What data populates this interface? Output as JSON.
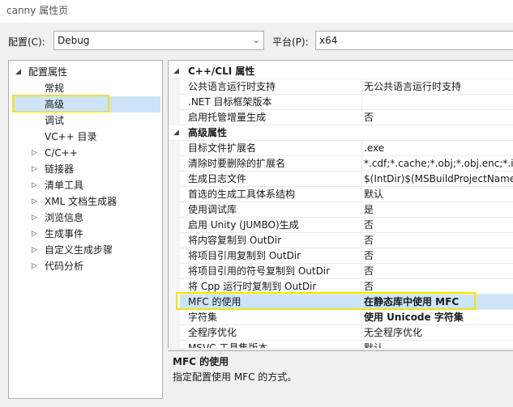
{
  "window": {
    "title": "canny 属性页"
  },
  "config": {
    "config_label": "配置(C):",
    "config_value": "Debug",
    "platform_label": "平台(P):",
    "platform_value": "x64"
  },
  "tree": {
    "items": [
      {
        "label": "配置属性",
        "expander": "◢"
      },
      {
        "label": "常规"
      },
      {
        "label": "高级"
      },
      {
        "label": "调试"
      },
      {
        "label": "VC++ 目录"
      },
      {
        "label": "C/C++",
        "expander": "▷"
      },
      {
        "label": "链接器",
        "expander": "▷"
      },
      {
        "label": "清单工具",
        "expander": "▷"
      },
      {
        "label": "XML 文档生成器",
        "expander": "▷"
      },
      {
        "label": "浏览信息",
        "expander": "▷"
      },
      {
        "label": "生成事件",
        "expander": "▷"
      },
      {
        "label": "自定义生成步骤",
        "expander": "▷"
      },
      {
        "label": "代码分析",
        "expander": "▷"
      }
    ]
  },
  "grid": {
    "categories": [
      {
        "label": "C++/CLI 属性",
        "caret": "◢",
        "rows": [
          {
            "name": "公共语言运行时支持",
            "value": "无公共语言运行时支持"
          },
          {
            "name": ".NET 目标框架版本",
            "value": ""
          },
          {
            "name": "启用托管增量生成",
            "value": "否"
          }
        ]
      },
      {
        "label": "高级属性",
        "caret": "◢",
        "rows": [
          {
            "name": "目标文件扩展名",
            "value": ".exe"
          },
          {
            "name": "清除时要删除的扩展名",
            "value": "*.cdf;*.cache;*.obj;*.obj.enc;*.ilk;*"
          },
          {
            "name": "生成日志文件",
            "value": "$(IntDir)$(MSBuildProjectName)"
          },
          {
            "name": "首选的生成工具体系结构",
            "value": "默认"
          },
          {
            "name": "使用调试库",
            "value": "是"
          },
          {
            "name": "启用 Unity (JUMBO)生成",
            "value": "否"
          },
          {
            "name": "将内容复制到 OutDir",
            "value": "否"
          },
          {
            "name": "将项目引用复制到 OutDir",
            "value": "否"
          },
          {
            "name": "将项目引用的符号复制到 OutDir",
            "value": "否"
          },
          {
            "name": "将 Cpp 运行时复制到 OutDir",
            "value": "否"
          },
          {
            "name": "MFC 的使用",
            "value": "在静态库中使用 MFC"
          },
          {
            "name": "字符集",
            "value": "使用 Unicode 字符集"
          },
          {
            "name": "全程序优化",
            "value": "无全程序优化"
          },
          {
            "name": "MSVC 工具集版本",
            "value": "默认"
          }
        ]
      }
    ]
  },
  "description": {
    "title": "MFC 的使用",
    "text": "指定配置使用 MFC 的方式。"
  },
  "colors": {
    "highlight": "#f2e600",
    "selection": "#cce4f7"
  }
}
